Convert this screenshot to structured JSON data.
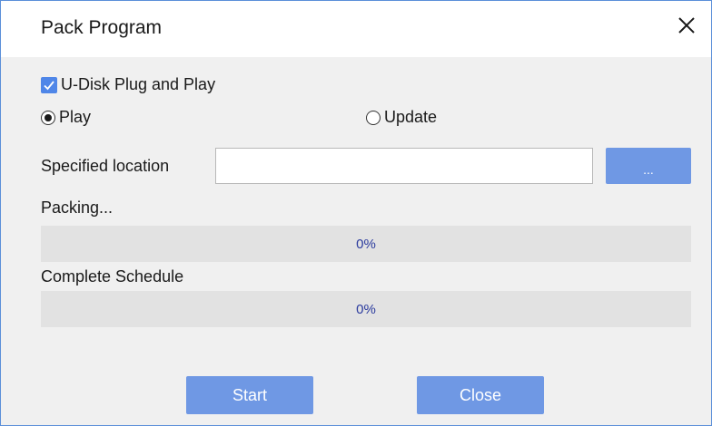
{
  "dialog": {
    "title": "Pack Program",
    "close_icon": "close-icon"
  },
  "options": {
    "udisk_label": "U-Disk Plug and Play",
    "udisk_checked": true,
    "play_label": "Play",
    "update_label": "Update",
    "selected_mode": "Play"
  },
  "location": {
    "label": "Specified location",
    "value": "",
    "browse_label": "..."
  },
  "packing": {
    "label": "Packing...",
    "percent_text": "0%",
    "progress": 0
  },
  "schedule": {
    "label": "Complete Schedule",
    "percent_text": "0%",
    "progress": 0
  },
  "buttons": {
    "start_label": "Start",
    "close_label": "Close"
  },
  "colors": {
    "accent": "#4f86e8",
    "button": "#6f98e4",
    "percent_text": "#2b3b9e",
    "window_border": "#5b8fd9"
  }
}
